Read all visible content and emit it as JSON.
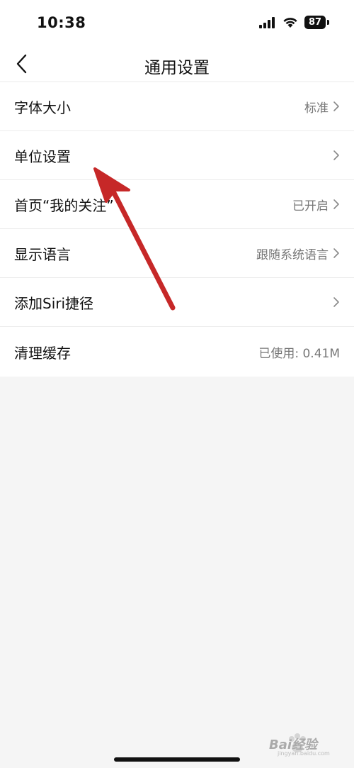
{
  "status_bar": {
    "time": "10:38",
    "battery": "87",
    "icons": [
      "signal-icon",
      "wifi-icon",
      "battery-icon"
    ]
  },
  "nav": {
    "title": "通用设置",
    "back_icon": "chevron-left-icon"
  },
  "settings": [
    {
      "label": "字体大小",
      "value": "标准",
      "chevron": true
    },
    {
      "label": "单位设置",
      "value": "",
      "chevron": true
    },
    {
      "label": "首页“我的关注”",
      "value": "已开启",
      "chevron": true
    },
    {
      "label": "显示语言",
      "value": "跟随系统语言",
      "chevron": true
    },
    {
      "label": "添加Siri捷径",
      "value": "",
      "chevron": true
    },
    {
      "label": "清理缓存",
      "value": "已使用: 0.41M",
      "chevron": false
    }
  ],
  "annotation": {
    "color": "#c62828"
  },
  "watermark": {
    "text": "Bai经验",
    "sub": "jingyan.baidu.com"
  },
  "colors": {
    "background": "#f5f5f5",
    "surface": "#ffffff",
    "secondary_text": "#777777"
  }
}
